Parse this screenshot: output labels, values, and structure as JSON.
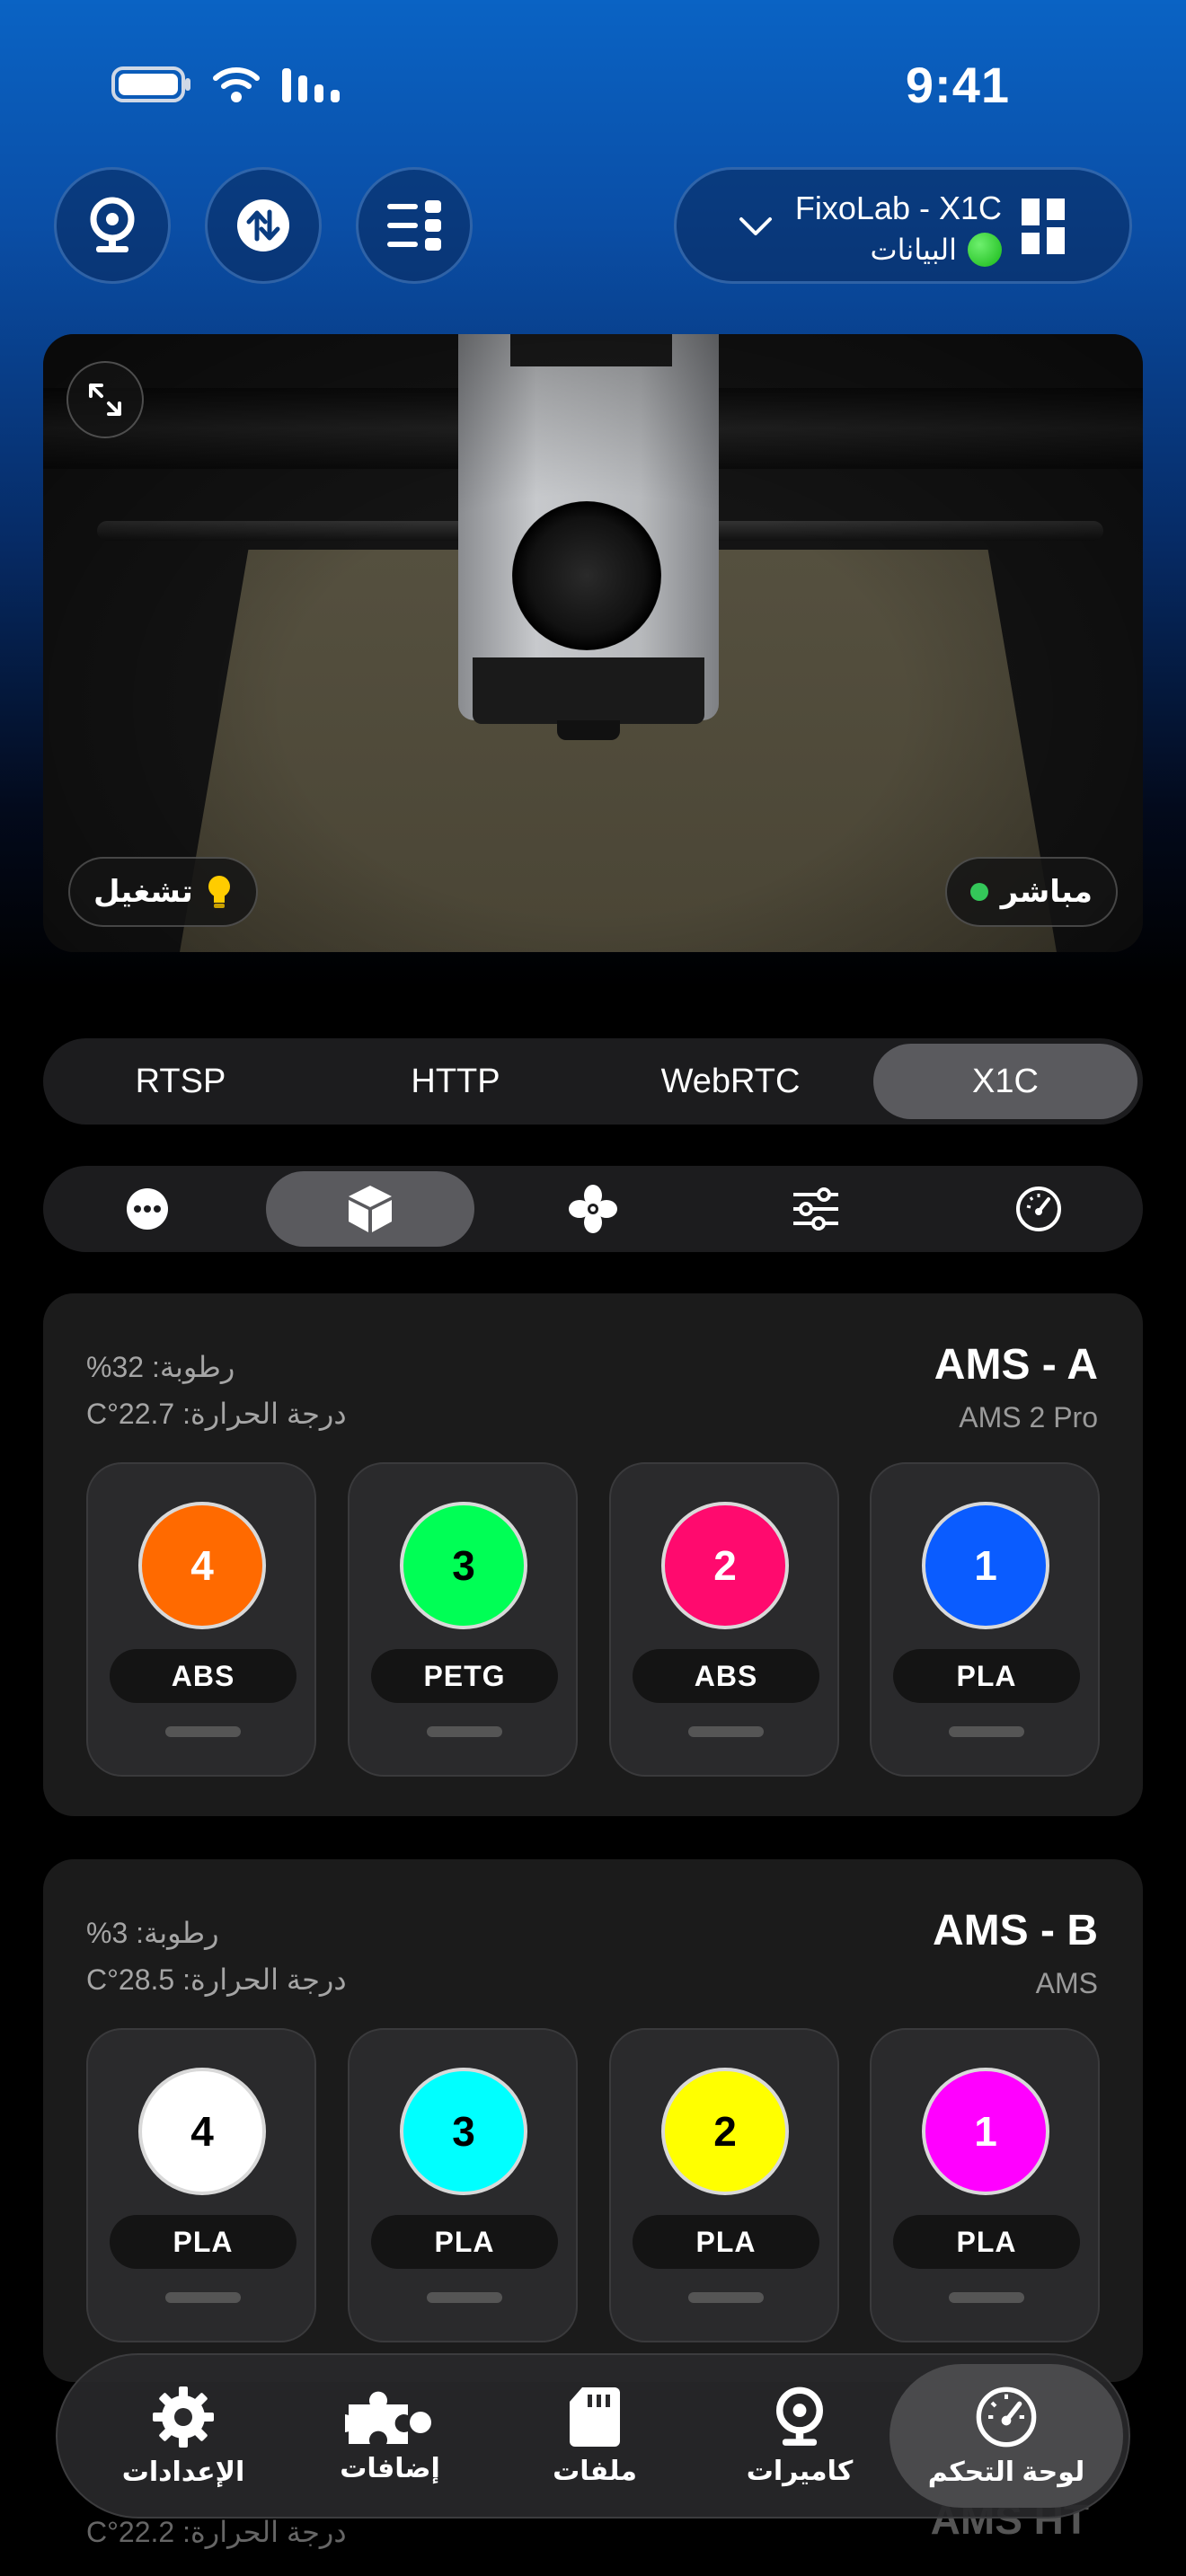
{
  "status_bar": {
    "time": "9:41"
  },
  "top_bar": {
    "printer_name": "FixoLab - X1C",
    "printer_status": "البيانات",
    "buttons": [
      "webcam-icon",
      "transfer-icon",
      "list-icon"
    ]
  },
  "camera": {
    "live_label": "مباشر",
    "light_label": "تشغيل",
    "live_color": "#34c759",
    "light_icon": "lightbulb-icon"
  },
  "stream_tabs": {
    "items": [
      "RTSP",
      "HTTP",
      "WebRTC",
      "X1C"
    ],
    "active": "X1C"
  },
  "section_tabs": {
    "items": [
      "more-icon",
      "box-icon",
      "fan-icon",
      "sliders-icon",
      "gauge-icon"
    ],
    "active": "box-icon"
  },
  "ams_units": [
    {
      "title": "AMS - A",
      "model": "AMS 2 Pro",
      "humidity": "رطوبة: 32%",
      "temperature": "درجة الحرارة: 22.7°C",
      "slots": [
        {
          "number": "1",
          "material": "PLA",
          "color": "#0a5cff"
        },
        {
          "number": "2",
          "material": "ABS",
          "color": "#ff0a6e"
        },
        {
          "number": "3",
          "material": "PETG",
          "color": "#00ff55"
        },
        {
          "number": "4",
          "material": "ABS",
          "color": "#ff6a00"
        }
      ]
    },
    {
      "title": "AMS - B",
      "model": "AMS",
      "humidity": "رطوبة: 3%",
      "temperature": "درجة الحرارة: 28.5°C",
      "slots": [
        {
          "number": "1",
          "material": "PLA",
          "color": "#ff00ff"
        },
        {
          "number": "2",
          "material": "PLA",
          "color": "#ffff00"
        },
        {
          "number": "3",
          "material": "PLA",
          "color": "#00ffff"
        },
        {
          "number": "4",
          "material": "PLA",
          "color": "#ffffff"
        }
      ]
    }
  ],
  "next_card_peek": {
    "title": "AMS HT",
    "temperature": "درجة الحرارة: 22.2°C"
  },
  "tab_bar": {
    "items": [
      {
        "label": "الإعدادات",
        "icon": "gear-icon"
      },
      {
        "label": "إضافات",
        "icon": "puzzle-icon"
      },
      {
        "label": "ملفات",
        "icon": "sd-card-icon"
      },
      {
        "label": "كاميرات",
        "icon": "webcam-icon"
      },
      {
        "label": "لوحة التحكم",
        "icon": "gauge-icon"
      }
    ],
    "active": "لوحة التحكم"
  }
}
